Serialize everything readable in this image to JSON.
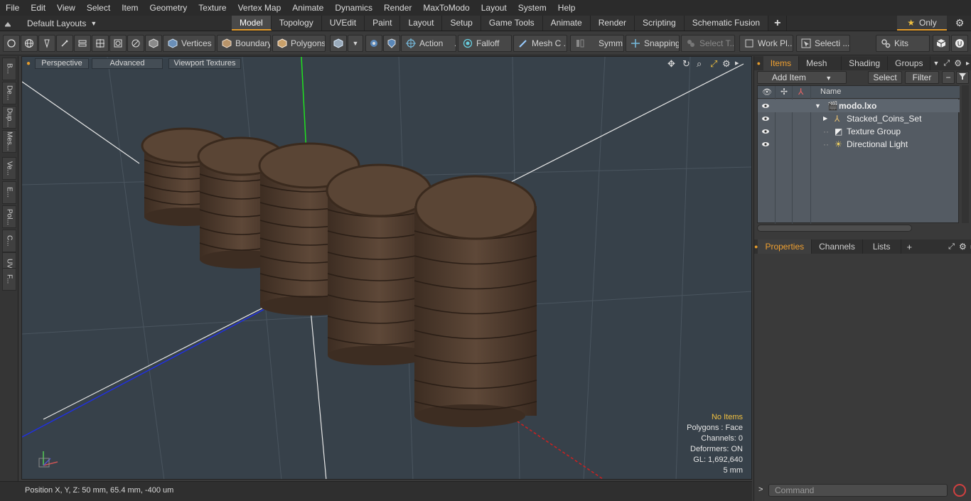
{
  "menu": [
    "File",
    "Edit",
    "View",
    "Select",
    "Item",
    "Geometry",
    "Texture",
    "Vertex Map",
    "Animate",
    "Dynamics",
    "Render",
    "MaxToModo",
    "Layout",
    "System",
    "Help"
  ],
  "layout": {
    "label": "Default Layouts"
  },
  "tabs": [
    "Model",
    "Topology",
    "UVEdit",
    "Paint",
    "Layout",
    "Setup",
    "Game Tools",
    "Animate",
    "Render",
    "Scripting",
    "Schematic Fusion"
  ],
  "active_tab": "Model",
  "only_label": "Only",
  "toolbar": {
    "vertices": "Vertices",
    "boundary": "Boundary",
    "polygons": "Polygons",
    "action": "Action",
    "falloff": "Falloff",
    "mesh": "Mesh C ...",
    "symm": "Symm ...",
    "snapping": "Snapping",
    "select_t": "Select T...",
    "work_pl": "Work Pl...",
    "selecti": "Selecti ...",
    "kits": "Kits"
  },
  "left_tabs": [
    "B...",
    "De...",
    "Dup...",
    "Mes...",
    "Ve...",
    "E...",
    "Pol...",
    "C...",
    "UV",
    "F..."
  ],
  "viewport": {
    "perspective": "Perspective",
    "advanced": "Advanced",
    "viewport_textures": "Viewport Textures",
    "stats": {
      "no_items": "No Items",
      "polygons": "Polygons : Face",
      "channels": "Channels: 0",
      "deformers": "Deformers: ON",
      "gl": "GL: 1,692,640",
      "scale": "5 mm"
    }
  },
  "status": {
    "position": "Position X, Y, Z:   50 mm, 65.4 mm, -400 um"
  },
  "items_panel": {
    "tabs": [
      "Items",
      "Mesh ...",
      "Shading",
      "Groups"
    ],
    "add_item": "Add Item",
    "select": "Select",
    "filter": "Filter",
    "name_header": "Name",
    "items": [
      {
        "name": "modo.lxo",
        "level": 0,
        "bold": true
      },
      {
        "name": "Stacked_Coins_Set",
        "level": 1,
        "bold": false
      },
      {
        "name": "Texture Group",
        "level": 1,
        "bold": false
      },
      {
        "name": "Directional Light",
        "level": 1,
        "bold": false
      }
    ]
  },
  "properties_panel": {
    "tabs": [
      "Properties",
      "Channels",
      "Lists"
    ]
  },
  "command": {
    "placeholder": "Command"
  },
  "colors": {
    "accent": "#e39b2c",
    "viewport_bg": "#37414a",
    "coin": "#5a4535"
  }
}
